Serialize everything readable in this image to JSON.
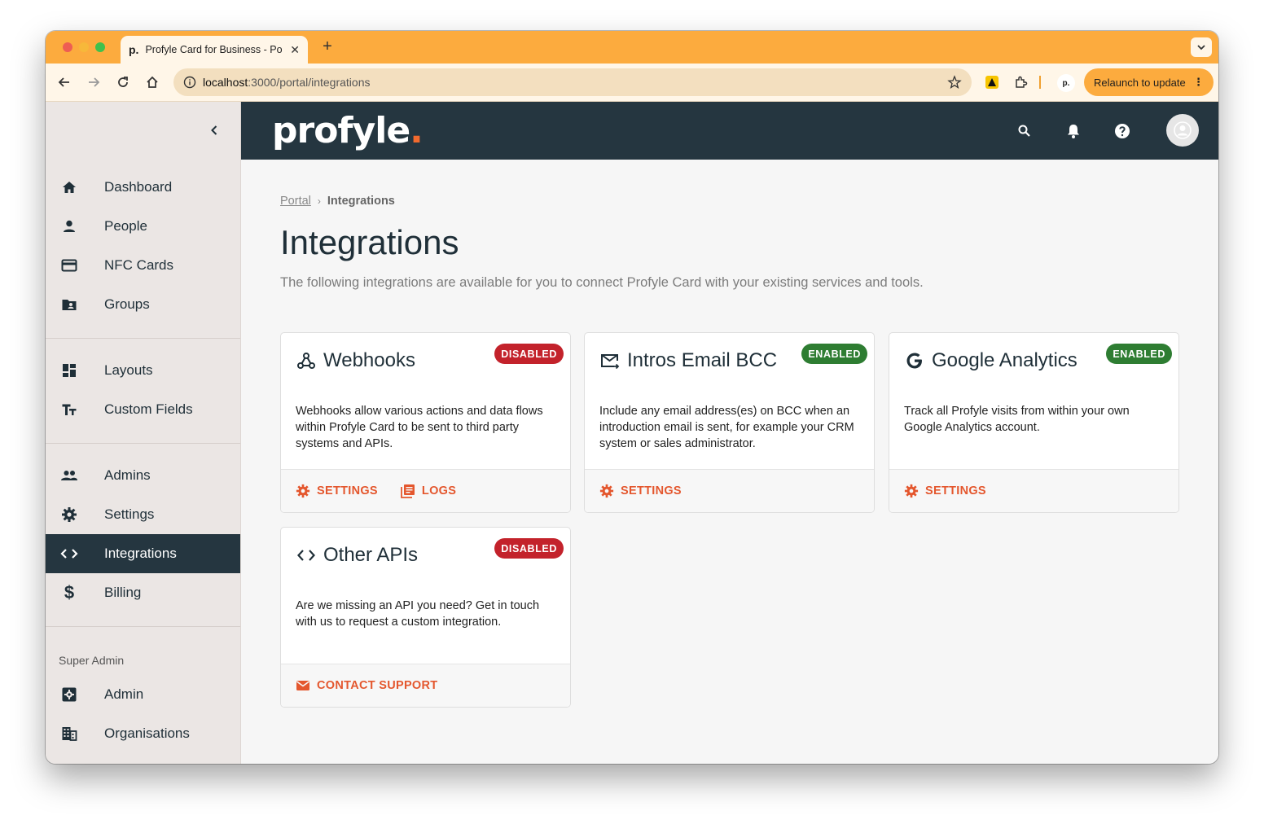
{
  "browser": {
    "tab_title": "Profyle Card for Business - Po",
    "tab_favicon": "p.",
    "url_host": "localhost",
    "url_path": ":3000/portal/integrations",
    "relaunch_label": "Relaunch to update",
    "profile_badge": "p."
  },
  "sidebar": {
    "items": [
      {
        "label": "Dashboard",
        "icon": "home-icon"
      },
      {
        "label": "People",
        "icon": "person-icon"
      },
      {
        "label": "NFC Cards",
        "icon": "card-icon"
      },
      {
        "label": "Groups",
        "icon": "folder-user-icon"
      },
      {
        "label": "Layouts",
        "icon": "dashboard-layout-icon"
      },
      {
        "label": "Custom Fields",
        "icon": "text-fields-icon"
      },
      {
        "label": "Admins",
        "icon": "people-icon"
      },
      {
        "label": "Settings",
        "icon": "gear-icon"
      },
      {
        "label": "Integrations",
        "icon": "code-icon",
        "active": true
      },
      {
        "label": "Billing",
        "icon": "dollar-icon"
      }
    ],
    "section_label": "Super Admin",
    "super_items": [
      {
        "label": "Admin",
        "icon": "admin-settings-icon"
      },
      {
        "label": "Organisations",
        "icon": "building-icon"
      }
    ]
  },
  "header": {
    "logo_text": "profyle",
    "logo_dot": "."
  },
  "breadcrumb": {
    "root": "Portal",
    "current": "Integrations"
  },
  "page": {
    "title": "Integrations",
    "description": "The following integrations are available for you to connect Profyle Card with your existing services and tools."
  },
  "cards": [
    {
      "title": "Webhooks",
      "status": "DISABLED",
      "body": "Webhooks allow various actions and data flows within Profyle Card to be sent to third party systems and APIs.",
      "actions": [
        "SETTINGS",
        "LOGS"
      ]
    },
    {
      "title": "Intros Email BCC",
      "status": "ENABLED",
      "body": "Include any email address(es) on BCC when an introduction email is sent, for example your CRM system or sales administrator.",
      "actions": [
        "SETTINGS"
      ]
    },
    {
      "title": "Google Analytics",
      "status": "ENABLED",
      "body": "Track all Profyle visits from within your own Google Analytics account.",
      "actions": [
        "SETTINGS"
      ]
    },
    {
      "title": "Other APIs",
      "status": "DISABLED",
      "body": "Are we missing an API you need? Get in touch with us to request a custom integration.",
      "actions": [
        "CONTACT SUPPORT"
      ]
    }
  ],
  "colors": {
    "accent": "#e4572e",
    "topbar": "#253640",
    "enabled": "#2e7d32",
    "disabled": "#c3222b",
    "browser_frame": "#fcab3e"
  }
}
